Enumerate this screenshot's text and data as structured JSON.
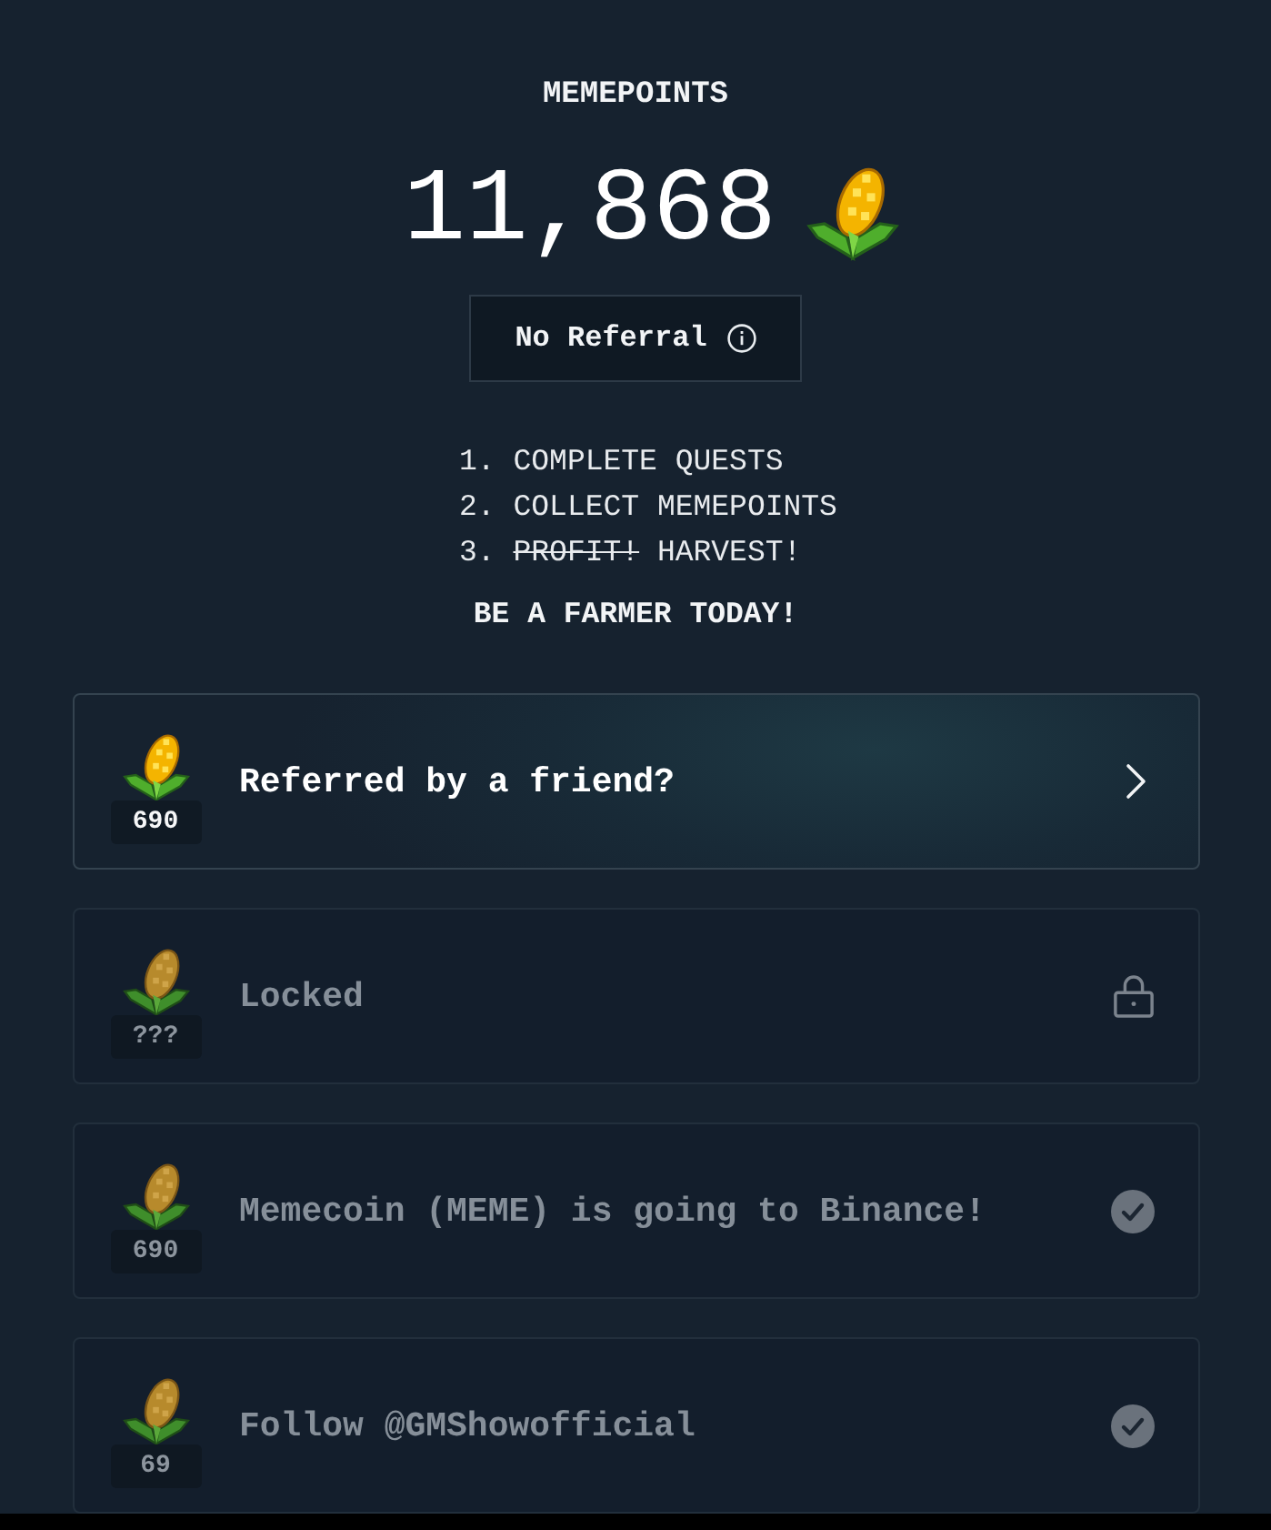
{
  "header": {
    "title": "MEMEPOINTS",
    "points": "11,868"
  },
  "referral": {
    "label": "No Referral"
  },
  "steps": [
    {
      "number": "1.",
      "text": "COMPLETE QUESTS"
    },
    {
      "number": "2.",
      "text": "COLLECT MEMEPOINTS"
    },
    {
      "number": "3.",
      "struck_text": "PROFIT!",
      "text": "HARVEST!"
    }
  ],
  "tagline": "BE A FARMER TODAY!",
  "quests": [
    {
      "kind": "open",
      "title": "Referred by a friend?",
      "reward": "690"
    },
    {
      "kind": "locked",
      "title": "Locked",
      "reward": "???"
    },
    {
      "kind": "completed",
      "title": "Memecoin (MEME) is going to Binance!",
      "reward": "690"
    },
    {
      "kind": "completed",
      "title": "Follow @GMShowofficial",
      "reward": "69"
    }
  ]
}
